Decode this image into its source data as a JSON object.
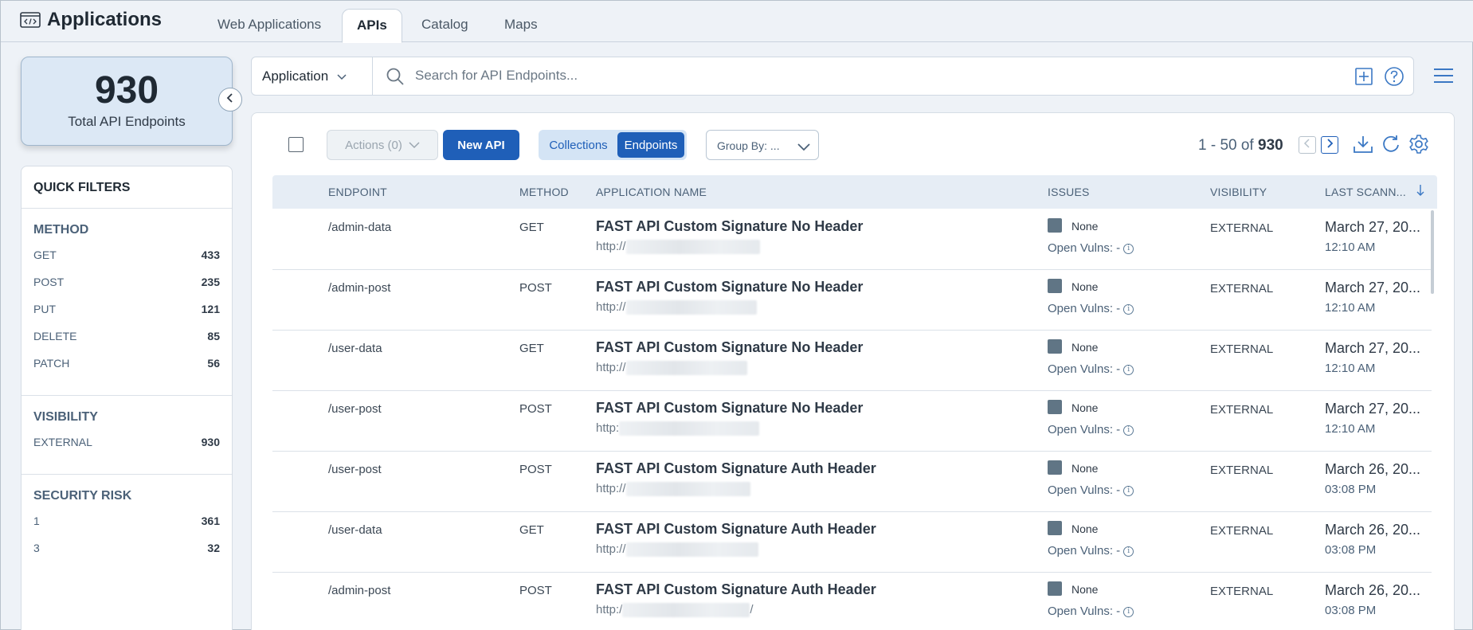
{
  "header": {
    "title": "Applications",
    "tabs": [
      {
        "label": "Web Applications",
        "active": false
      },
      {
        "label": "APIs",
        "active": true
      },
      {
        "label": "Catalog",
        "active": false
      },
      {
        "label": "Maps",
        "active": false
      }
    ]
  },
  "summary": {
    "total": "930",
    "label": "Total API Endpoints"
  },
  "quick_filters": {
    "title": "QUICK FILTERS",
    "sections": [
      {
        "title": "METHOD",
        "items": [
          {
            "label": "GET",
            "count": "433"
          },
          {
            "label": "POST",
            "count": "235"
          },
          {
            "label": "PUT",
            "count": "121"
          },
          {
            "label": "DELETE",
            "count": "85"
          },
          {
            "label": "PATCH",
            "count": "56"
          }
        ]
      },
      {
        "title": "VISIBILITY",
        "items": [
          {
            "label": "EXTERNAL",
            "count": "930"
          }
        ]
      },
      {
        "title": "SECURITY RISK",
        "items": [
          {
            "label": "1",
            "count": "361"
          },
          {
            "label": "3",
            "count": "32"
          }
        ]
      }
    ]
  },
  "search": {
    "scope": "Application",
    "placeholder": "Search for API Endpoints..."
  },
  "toolbar": {
    "actions_label": "Actions (0)",
    "new_api_label": "New API",
    "view_toggle": [
      "Collections",
      "Endpoints"
    ],
    "active_view": "Endpoints",
    "group_by_label": "Group By: ...",
    "pager_range": "1 - 50 of",
    "pager_total": "930"
  },
  "table": {
    "columns": [
      "ENDPOINT",
      "METHOD",
      "APPLICATION NAME",
      "ISSUES",
      "VISIBILITY",
      "LAST SCANN..."
    ],
    "rows": [
      {
        "endpoint": "/admin-data",
        "method": "GET",
        "app": "FAST API Custom Signature No Header",
        "url_prefix": "http://",
        "url_suffix": "",
        "issues": "None",
        "vulns": "Open Vulns: -",
        "visibility": "EXTERNAL",
        "date": "March 27, 20...",
        "time": "12:10 AM"
      },
      {
        "endpoint": "/admin-post",
        "method": "POST",
        "app": "FAST API Custom Signature No Header",
        "url_prefix": "http://",
        "url_suffix": "",
        "issues": "None",
        "vulns": "Open Vulns: -",
        "visibility": "EXTERNAL",
        "date": "March 27, 20...",
        "time": "12:10 AM"
      },
      {
        "endpoint": "/user-data",
        "method": "GET",
        "app": "FAST API Custom Signature No Header",
        "url_prefix": "http://",
        "url_suffix": "",
        "issues": "None",
        "vulns": "Open Vulns: -",
        "visibility": "EXTERNAL",
        "date": "March 27, 20...",
        "time": "12:10 AM"
      },
      {
        "endpoint": "/user-post",
        "method": "POST",
        "app": "FAST API Custom Signature No Header",
        "url_prefix": "http:",
        "url_suffix": "",
        "issues": "None",
        "vulns": "Open Vulns: -",
        "visibility": "EXTERNAL",
        "date": "March 27, 20...",
        "time": "12:10 AM"
      },
      {
        "endpoint": "/user-post",
        "method": "POST",
        "app": "FAST API Custom Signature Auth Header",
        "url_prefix": "http://",
        "url_suffix": "",
        "issues": "None",
        "vulns": "Open Vulns: -",
        "visibility": "EXTERNAL",
        "date": "March 26, 20...",
        "time": "03:08 PM"
      },
      {
        "endpoint": "/user-data",
        "method": "GET",
        "app": "FAST API Custom Signature Auth Header",
        "url_prefix": "http://",
        "url_suffix": "",
        "issues": "None",
        "vulns": "Open Vulns: -",
        "visibility": "EXTERNAL",
        "date": "March 26, 20...",
        "time": "03:08 PM"
      },
      {
        "endpoint": "/admin-post",
        "method": "POST",
        "app": "FAST API Custom Signature Auth Header",
        "url_prefix": "http:/",
        "url_suffix": "/",
        "issues": "None",
        "vulns": "Open Vulns: -",
        "visibility": "EXTERNAL",
        "date": "March 26, 20...",
        "time": "03:08 PM"
      }
    ]
  },
  "colors": {
    "primary": "#1f5fb8",
    "toggle_bg": "#d4e4f5",
    "issue_box": "#607585",
    "header_bg": "#eef2f7"
  }
}
